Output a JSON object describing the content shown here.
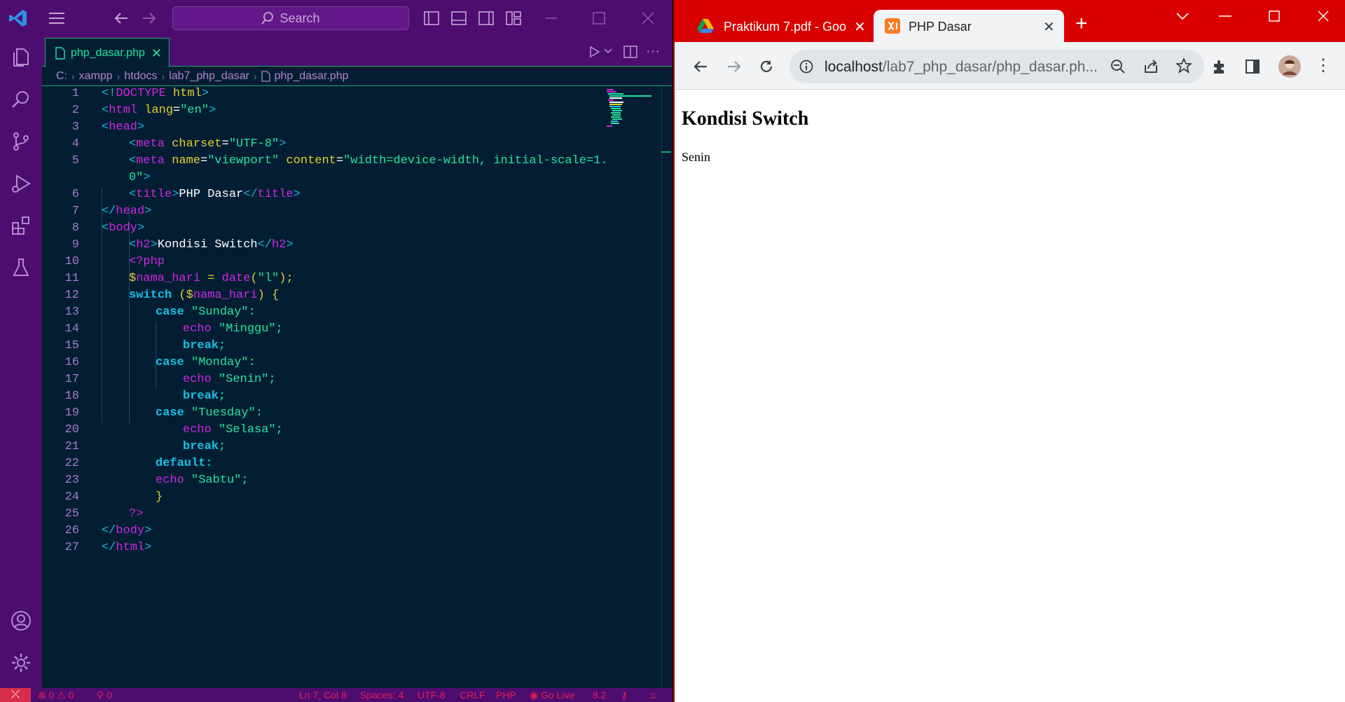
{
  "vscode": {
    "search_placeholder": "Search",
    "tab_label": "php_dasar.php",
    "breadcrumb": [
      "C:",
      "xampp",
      "htdocs",
      "lab7_php_dasar",
      "php_dasar.php"
    ],
    "status": {
      "errors": "0",
      "warnings": "0",
      "ports": "0",
      "position": "Ln 7, Col 8",
      "spaces": "Spaces: 4",
      "encoding": "UTF-8",
      "eol": "CRLF",
      "language": "PHP",
      "golive": "Go Live",
      "php_version": "8.2"
    },
    "code_lines": [
      "1",
      "2",
      "3",
      "4",
      "5",
      "",
      "6",
      "7",
      "8",
      "9",
      "10",
      "11",
      "12",
      "13",
      "14",
      "15",
      "16",
      "17",
      "18",
      "19",
      "20",
      "21",
      "22",
      "23",
      "24",
      "25",
      "26",
      "27"
    ]
  },
  "code": {
    "l1": [
      "<!",
      "DOCTYPE",
      " html",
      ">"
    ],
    "l2": [
      "<",
      "html",
      " lang",
      "=",
      "\"en\"",
      ">"
    ],
    "l3": [
      "<",
      "head",
      ">"
    ],
    "l4": [
      "<",
      "meta",
      " charset",
      "=",
      "\"UTF-8\"",
      ">"
    ],
    "l5a": [
      "<",
      "meta",
      " name",
      "=",
      "\"viewport\"",
      " content",
      "=",
      "\"width=device-width, initial-scale=1."
    ],
    "l5b": [
      "0\"",
      ">"
    ],
    "l6": [
      "<",
      "title",
      ">",
      "PHP Dasar",
      "</",
      "title",
      ">"
    ],
    "l7": [
      "</",
      "head",
      ">"
    ],
    "l8": [
      "<",
      "body",
      ">"
    ],
    "l9": [
      "<",
      "h2",
      ">",
      "Kondisi Switch",
      "</",
      "h2",
      ">"
    ],
    "l10": "<?php",
    "l11": [
      "$",
      "nama_hari",
      " = ",
      "date",
      "(",
      "\"l\"",
      ");"
    ],
    "l12": [
      "switch",
      " (",
      "$",
      "nama_hari",
      ") {"
    ],
    "l13": [
      "case",
      " \"Sunday\"",
      ":"
    ],
    "l14": [
      "echo",
      " \"Minggu\"",
      ";"
    ],
    "l15": [
      "break",
      ";"
    ],
    "l16": [
      "case",
      " \"Monday\"",
      ":"
    ],
    "l17": [
      "echo",
      " \"Senin\"",
      ";"
    ],
    "l18": [
      "break",
      ";"
    ],
    "l19": [
      "case",
      " \"Tuesday\"",
      ":"
    ],
    "l20": [
      "echo",
      " \"Selasa\"",
      ";"
    ],
    "l21": [
      "break",
      ";"
    ],
    "l22": [
      "default",
      ":"
    ],
    "l23": [
      "echo",
      " \"Sabtu\"",
      ";"
    ],
    "l24": "}",
    "l25": "?>",
    "l26": [
      "</",
      "body",
      ">"
    ],
    "l27": [
      "</",
      "html",
      ">"
    ]
  },
  "chrome": {
    "tabs": [
      {
        "title": "Praktikum 7.pdf - Goo",
        "icon": "google-drive-icon"
      },
      {
        "title": "PHP Dasar",
        "icon": "xampp-icon"
      }
    ],
    "url_host": "localhost",
    "url_path": "/lab7_php_dasar/php_dasar.ph...",
    "page": {
      "heading": "Kondisi Switch",
      "output": "Senin"
    }
  }
}
